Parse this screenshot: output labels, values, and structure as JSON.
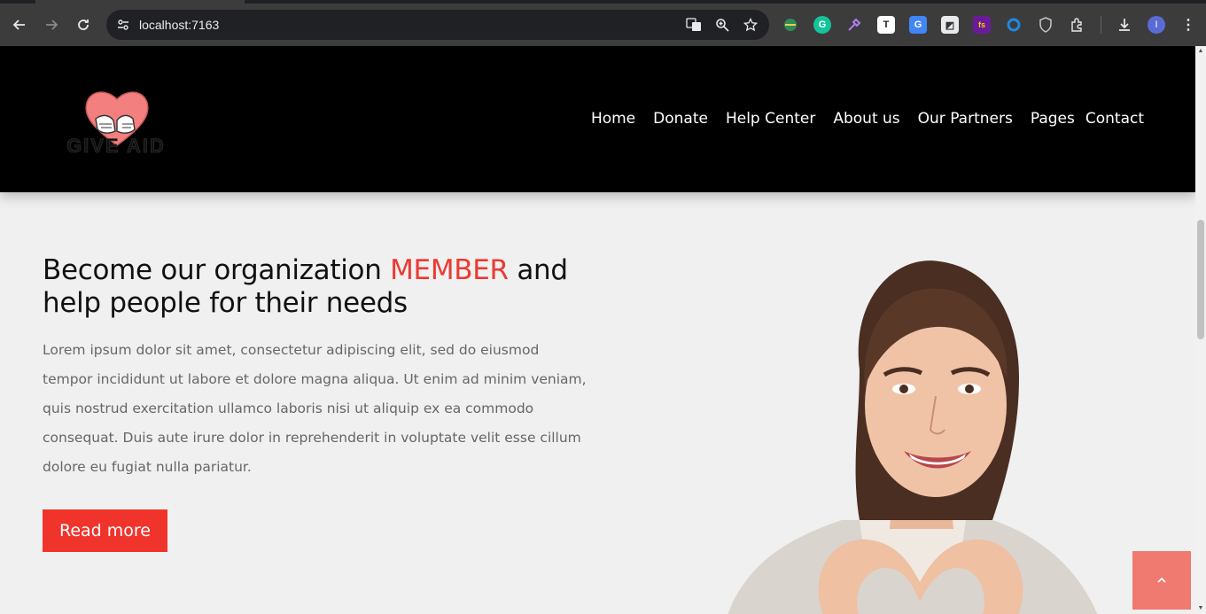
{
  "browser": {
    "url": "localhost:7163",
    "back_icon": "arrow-left-icon",
    "forward_icon": "arrow-right-icon",
    "reload_icon": "reload-icon",
    "profile_initial": "I"
  },
  "header": {
    "logo_text": "GIVE AID",
    "nav": [
      "Home",
      "Donate",
      "Help Center",
      "About us",
      "Our Partners",
      "Pages",
      "Contact"
    ]
  },
  "hero": {
    "title_before": "Become our organization ",
    "title_accent": "MEMBER",
    "title_after": " and help people for their needs",
    "body": "Lorem ipsum dolor sit amet, consectetur adipiscing elit, sed do eiusmod tempor incididunt ut labore et dolore magna aliqua. Ut enim ad minim veniam, quis nostrud exercitation ullamco laboris nisi ut aliquip ex ea commodo consequat. Duis aute irure dolor in reprehenderit in voluptate velit esse cillum dolore eu fugiat nulla pariatur.",
    "button": "Read more"
  },
  "colors": {
    "accent": "#ec3a32",
    "button": "#f0342c",
    "scroll_top": "#f07a70",
    "header_bg": "#000000"
  }
}
